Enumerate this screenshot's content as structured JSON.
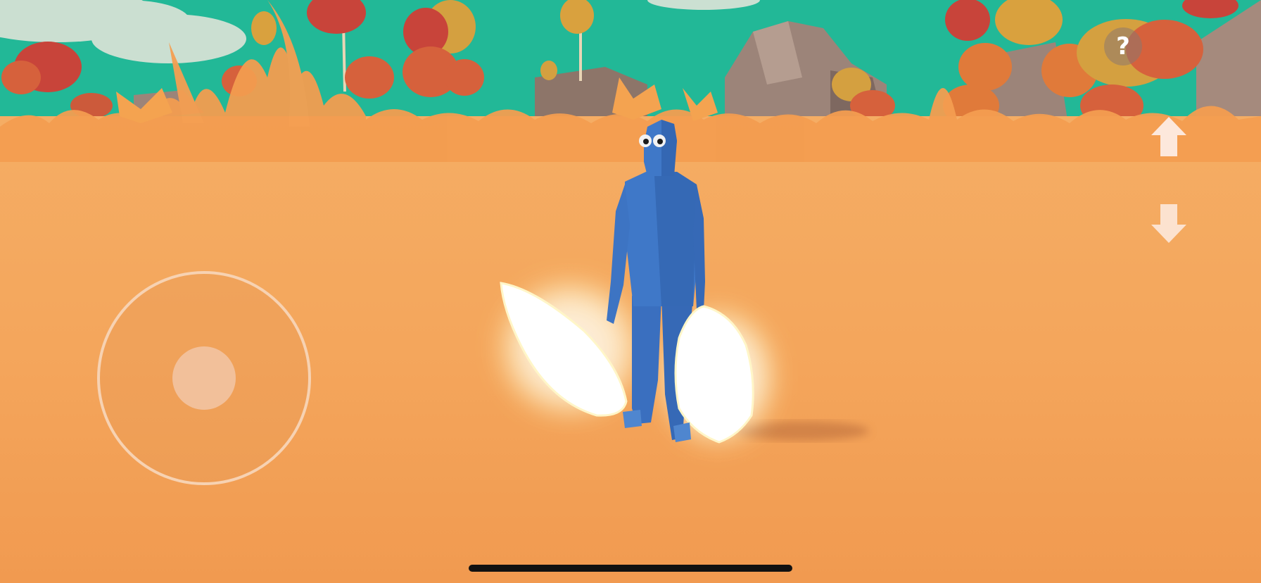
{
  "hud": {
    "help_label": "?"
  },
  "colors": {
    "sky": "#21b898",
    "ground": "#f3a35a",
    "grass": "#f29a50",
    "unit_blue": "#3b73c4",
    "glow": "#ffffff",
    "joystick_ring": "#f7d2b2"
  },
  "icons": {
    "help": "question-mark-icon",
    "camera_up": "arrow-up-icon",
    "camera_down": "arrow-down-icon"
  }
}
